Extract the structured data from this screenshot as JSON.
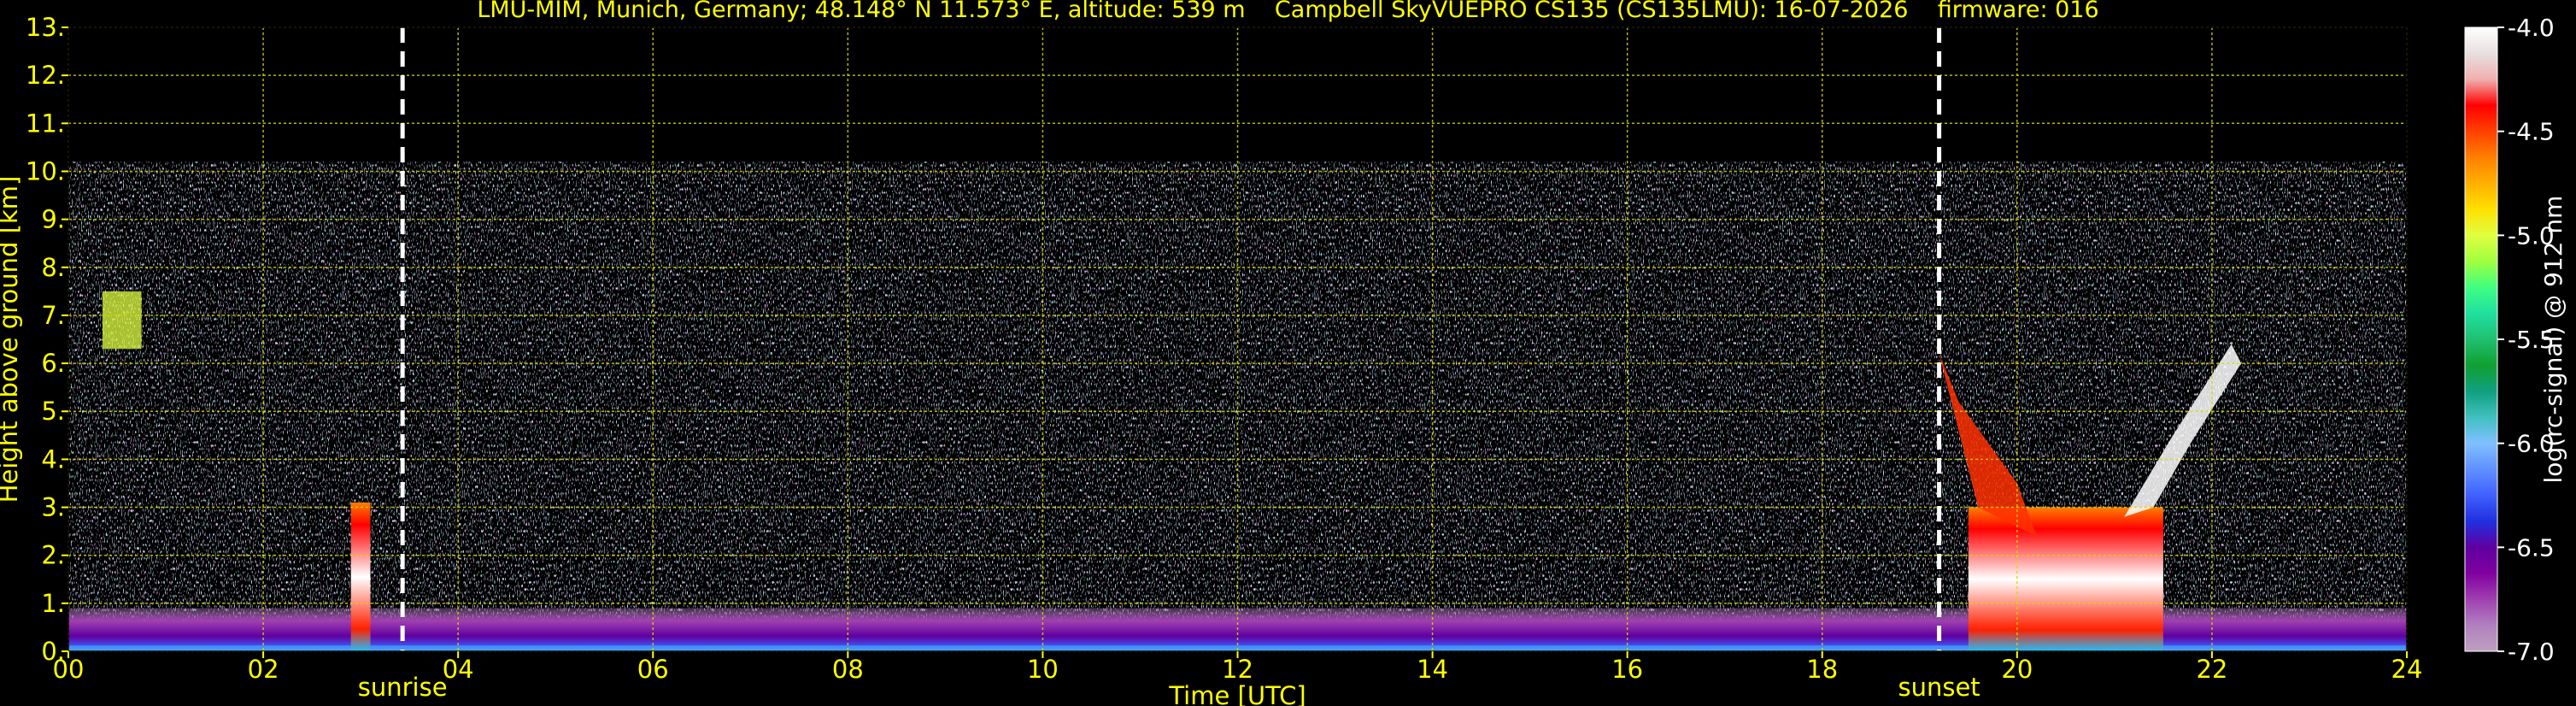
{
  "header": {
    "title": "LMU-MIM, Munich, Germany; 48.148° N 11.573° E, altitude: 539 m    Campbell SkyVUEPRO CS135 (CS135LMU): 16-07-2026    firmware: 016"
  },
  "chart_data": {
    "type": "heatmap",
    "xlabel": "Time [UTC]",
    "ylabel": "Height above ground [km]",
    "x_ticks": [
      "00",
      "02",
      "04",
      "06",
      "08",
      "10",
      "12",
      "14",
      "16",
      "18",
      "20",
      "22",
      "24"
    ],
    "y_ticks": [
      "0.",
      "1.",
      "2.",
      "3.",
      "4.",
      "5.",
      "6.",
      "7.",
      "8.",
      "9.",
      "10.",
      "11.",
      "12.",
      "13."
    ],
    "xlim": [
      0,
      24
    ],
    "ylim": [
      0,
      13
    ],
    "grid": true,
    "colorbar": {
      "label": "log(rc-signal) @ 912 nm",
      "range": [
        -7.0,
        -4.0
      ],
      "ticks": [
        "-4.0",
        "-4.5",
        "-5.0",
        "-5.5",
        "-6.0",
        "-6.5",
        "-7.0"
      ],
      "colors": [
        "#ffffff",
        "#e8e0e0",
        "#f0b0b0",
        "#ff0000",
        "#ff4000",
        "#ff8000",
        "#ffb000",
        "#ffe000",
        "#e0ff40",
        "#a0ff40",
        "#40ff80",
        "#20e0a0",
        "#20c070",
        "#10a030",
        "#10a080",
        "#40c0c0",
        "#80c0ff",
        "#6090ff",
        "#4060ff",
        "#2030e0",
        "#6000a0",
        "#8000a0",
        "#a040b0",
        "#b080c0",
        "#c0a0c0"
      ]
    },
    "annotations": [
      {
        "label": "sunrise",
        "x": 3.43
      },
      {
        "label": "sunset",
        "x": 19.2
      }
    ],
    "features": [
      {
        "name": "signal_top_km",
        "value": 10.2
      },
      {
        "name": "mixing_layer_night_km",
        "value": 0.9
      },
      {
        "name": "cloud_early_morning_x",
        "value": [
          2.9,
          3.1
        ]
      },
      {
        "name": "cloud_evening_x",
        "value": [
          19.5,
          21.5
        ]
      }
    ]
  }
}
